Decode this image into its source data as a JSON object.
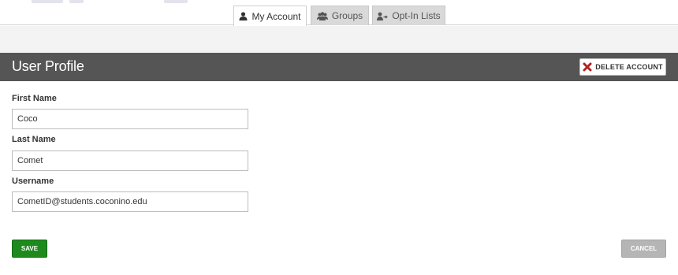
{
  "tabs": [
    {
      "label": "My Account",
      "icon": "user-icon",
      "active": true
    },
    {
      "label": "Groups",
      "icon": "group-icon",
      "active": false
    },
    {
      "label": "Opt-In Lists",
      "icon": "opt-in-icon",
      "active": false
    }
  ],
  "header": {
    "title": "User Profile",
    "delete_label": "DELETE ACCOUNT",
    "delete_icon": "close-icon"
  },
  "form": {
    "first_name": {
      "label": "First Name",
      "value": "Coco"
    },
    "last_name": {
      "label": "Last Name",
      "value": "Comet"
    },
    "username": {
      "label": "Username",
      "value": "CometID@students.coconino.edu"
    }
  },
  "actions": {
    "save_label": "SAVE",
    "cancel_label": "CANCEL"
  },
  "colors": {
    "header_bg": "#555555",
    "save_bg": "#1e8a1e",
    "cancel_bg": "#b5b5b5",
    "delete_icon": "#b22222"
  }
}
